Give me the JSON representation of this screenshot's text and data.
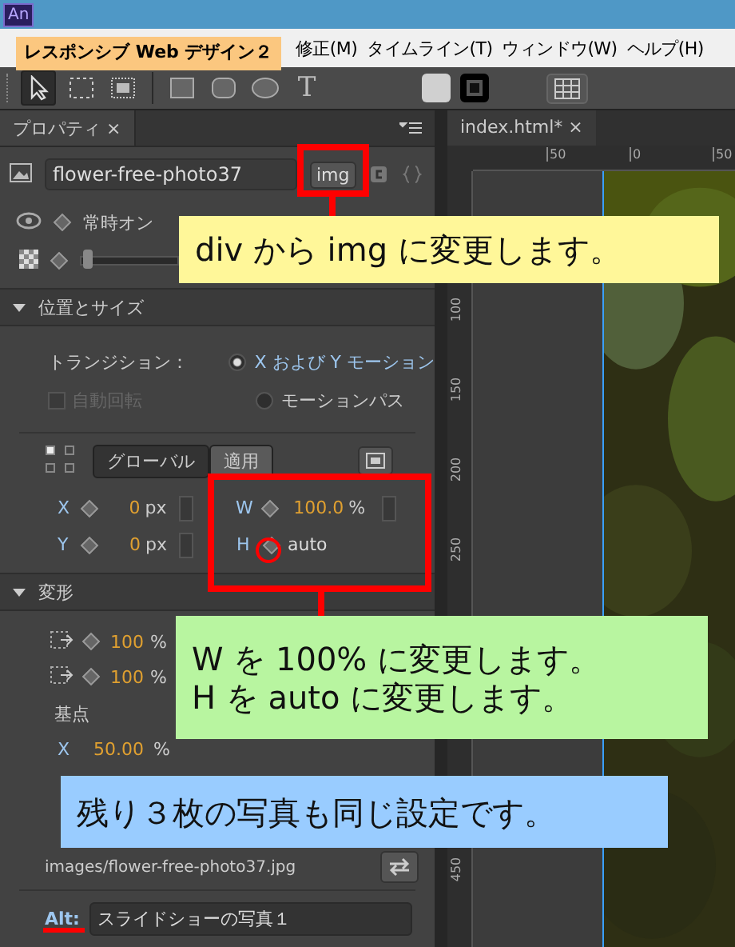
{
  "app_icon": "An",
  "menu": [
    {
      "label": "修正(M)"
    },
    {
      "label": "タイムライン(T)"
    },
    {
      "label": "ウィンドウ(W)"
    },
    {
      "label": "ヘルプ(H)"
    }
  ],
  "project_badge": "レスポンシブ Web デザイン２",
  "tools": [
    {
      "kind": "arrow",
      "selected": true
    },
    {
      "kind": "marquee",
      "selected": false
    },
    {
      "kind": "clip",
      "selected": false
    },
    {
      "kind": "rect",
      "selected": false
    },
    {
      "kind": "rounded",
      "selected": false
    },
    {
      "kind": "ellipse",
      "selected": false
    },
    {
      "kind": "text",
      "label": "T",
      "selected": false
    }
  ],
  "properties": {
    "tab": "プロパティ",
    "tab_close": "×",
    "element_name": "flower-free-photo37",
    "tag": "img",
    "visibility": "常時オン",
    "opacity": {
      "level": 0.02
    },
    "position_section": {
      "title": "位置とサイズ",
      "expanded": true,
      "transition_label": "トランジション：",
      "motion_options": [
        {
          "label": "X および Y モーション",
          "selected": true
        },
        {
          "label": "モーションパス",
          "selected": false
        }
      ],
      "auto_rotate": {
        "label": "自動回転",
        "checked": false,
        "disabled": true
      },
      "coordinate_modes": [
        {
          "label": "グローバル",
          "selected": true
        },
        {
          "label": "適用",
          "selected": false
        }
      ],
      "x": {
        "label": "X",
        "value": "0",
        "unit": "px"
      },
      "y": {
        "label": "Y",
        "value": "0",
        "unit": "px"
      },
      "w": {
        "label": "W",
        "value": "100.0",
        "unit": "%"
      },
      "h": {
        "label": "H",
        "value": "auto"
      }
    },
    "transform_section": {
      "title": "変形",
      "expanded": true,
      "scale": [
        {
          "value": "100",
          "unit": "%"
        },
        {
          "value": "100",
          "unit": "%"
        }
      ],
      "origin_label": "基点",
      "origin_x": {
        "label": "X",
        "value": "50.00",
        "unit": "%"
      }
    },
    "image_section": {
      "path": "images/flower-free-photo37.jpg",
      "alt_label": "Alt:",
      "alt_value": "スライドショーの写真１"
    }
  },
  "document": {
    "tab": "index.html*",
    "tab_close": "×",
    "top_ruler": [
      "50",
      "0",
      "50"
    ],
    "left_ruler": [
      "100",
      "150",
      "200",
      "250",
      "450"
    ]
  },
  "callouts": [
    {
      "lines": [
        "div から img に変更します。"
      ],
      "color": "#fff799"
    },
    {
      "lines": [
        "W を 100% に変更します。",
        "H を auto に変更します。"
      ],
      "color": "#b8f5a0"
    },
    {
      "lines": [
        "残り３枚の写真も同じ設定です。"
      ],
      "color": "#99ccff"
    }
  ]
}
